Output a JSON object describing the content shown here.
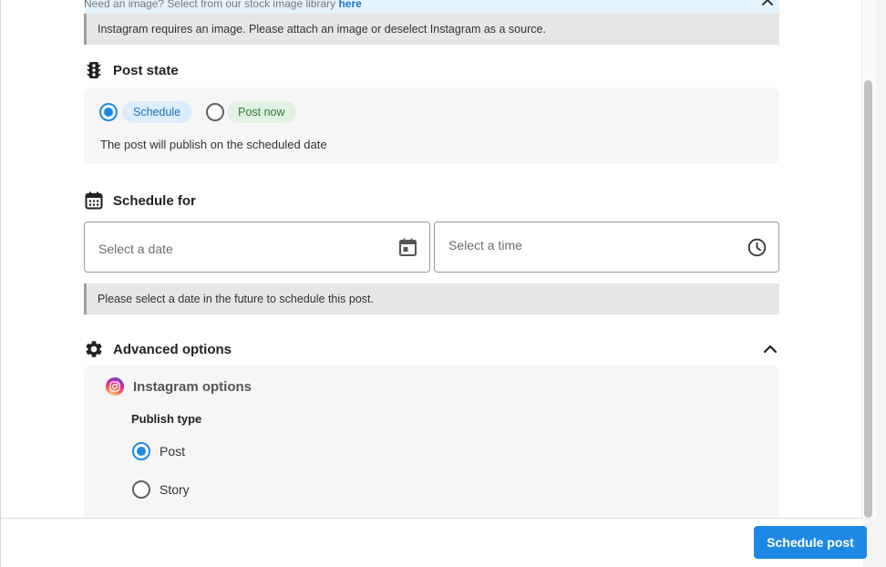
{
  "info_bar": {
    "text": "Need an image? Select from our stock image library ",
    "link": "here"
  },
  "instagram_notice": "Instagram requires an image. Please attach an image or deselect Instagram as a source.",
  "post_state": {
    "title": "Post state",
    "options": [
      {
        "label": "Schedule",
        "selected": true
      },
      {
        "label": "Post now",
        "selected": false
      }
    ],
    "description": "The post will publish on the scheduled date"
  },
  "schedule": {
    "title": "Schedule for",
    "date_placeholder": "Select a date",
    "time_placeholder": "Select a time",
    "notice": "Please select a date in the future to schedule this post."
  },
  "advanced": {
    "title": "Advanced options",
    "instagram": {
      "title": "Instagram options",
      "publish_type_label": "Publish type",
      "options": [
        {
          "label": "Post",
          "selected": true
        },
        {
          "label": "Story",
          "selected": false
        }
      ]
    }
  },
  "footer": {
    "submit_label": "Schedule post"
  },
  "colors": {
    "primary": "#1e88e5",
    "schedule_chip": "#dcecfa",
    "post_now_chip": "#e2f1e3",
    "notice_bg": "#e6e6e6"
  }
}
